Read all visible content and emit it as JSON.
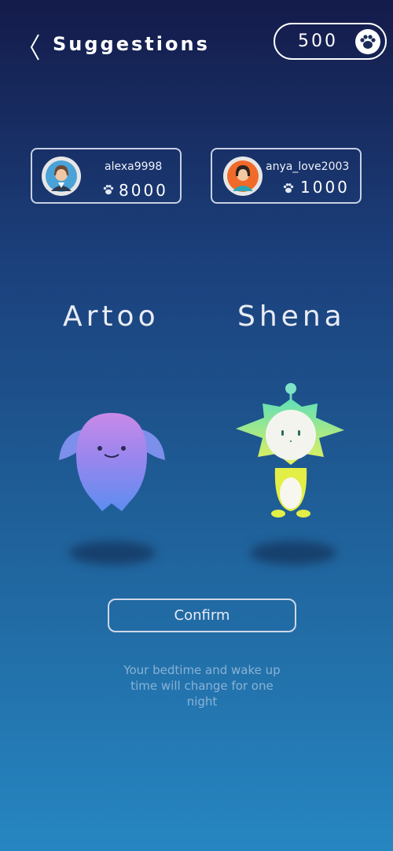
{
  "header": {
    "title": "Suggestions",
    "coins": "500",
    "back_icon": "chevron-left-icon",
    "coin_icon": "paw-icon"
  },
  "users": [
    {
      "name": "alexa9998",
      "score": "8000",
      "avatar_icon": "female-user-avatar"
    },
    {
      "name": "anya_love2003",
      "score": "1000",
      "avatar_icon": "female-user-avatar"
    }
  ],
  "pets": [
    {
      "name": "Artoo"
    },
    {
      "name": "Shena"
    }
  ],
  "confirm_label": "Confirm",
  "note": "Your bedtime and wake up time will change for one night",
  "colors": {
    "accent": "#ffffff",
    "bg_top": "#141b4a",
    "bg_bottom": "#2686c1"
  }
}
